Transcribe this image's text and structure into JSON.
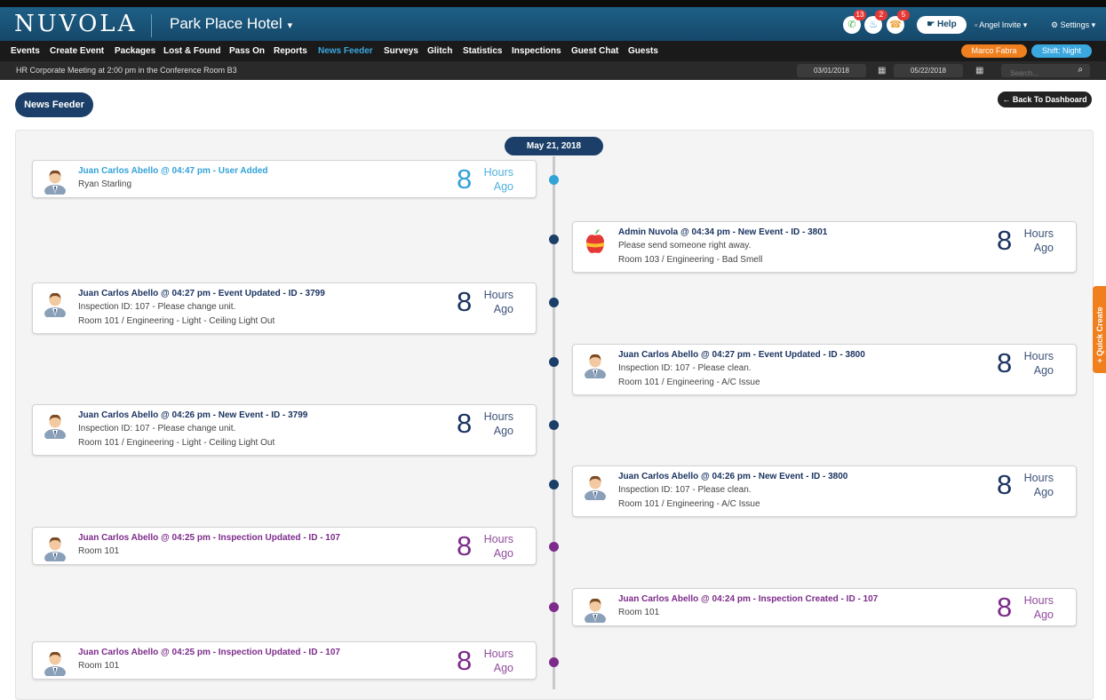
{
  "app": {
    "logo": "NUVOLA",
    "hotel": "Park Place Hotel",
    "hotel_caret": "▾"
  },
  "notifications": [
    {
      "name": "chat-notification-icon",
      "icon": "✆",
      "count": "13",
      "color": "#43b649"
    },
    {
      "name": "service-bell-notification-icon",
      "icon": "♨",
      "count": "2",
      "color": "#2f9ad6"
    },
    {
      "name": "phone-notification-icon",
      "icon": "☎",
      "count": "5",
      "color": "#f2a33a"
    }
  ],
  "top_right": {
    "help": "☛ Help",
    "invite": "▫ Angel Invite ▾",
    "settings": "⚙ Settings ▾"
  },
  "nav": {
    "items": [
      "Events",
      "Create Event",
      "Packages",
      "Lost & Found",
      "Pass On",
      "Reports",
      "News Feeder",
      "Surveys",
      "Glitch",
      "Statistics",
      "Inspections",
      "Guest Chat",
      "Guests"
    ],
    "active": "News Feeder",
    "user": "Marco Fabra",
    "shift": "Shift: Night"
  },
  "subbar": {
    "ticker": "HR Corporate Meeting at 2:00 pm in the Conference Room B3",
    "start_date": "03/01/2018",
    "end_date": "05/22/2018",
    "search_placeholder": "Search...",
    "cal_icon": "▦",
    "search_icon": "⌕"
  },
  "page": {
    "news_feeder_button": "News Feeder",
    "back_button": "← Back To Dashboard",
    "date_label": "May 21, 2018",
    "quick_create": "+ Quick Create"
  },
  "colors": {
    "user_added": "#32a2d9",
    "event": "#1b3461",
    "inspection": "#7d2b8b",
    "dot_event": "#1b3f68"
  },
  "feed": [
    {
      "title": "Juan Carlos Abello @ 04:47 pm - User Added",
      "lines": [
        "Ryan Starling"
      ],
      "num": "8",
      "unit_1": "Hours",
      "unit_2": "Ago",
      "kind": "user_added",
      "avatar": "user"
    },
    {
      "title": "Admin Nuvola @ 04:34 pm - New Event - ID - 3801",
      "lines": [
        "Please send someone right away.",
        "Room 103 / Engineering - Bad Smell"
      ],
      "num": "8",
      "unit_1": "Hours",
      "unit_2": "Ago",
      "kind": "event",
      "avatar": "apple"
    },
    {
      "title": "Juan Carlos Abello @ 04:27 pm - Event Updated - ID - 3799",
      "lines": [
        "Inspection ID: 107 - Please change unit.",
        "Room 101 / Engineering - Light - Ceiling Light Out"
      ],
      "num": "8",
      "unit_1": "Hours",
      "unit_2": "Ago",
      "kind": "event",
      "avatar": "user"
    },
    {
      "title": "Juan Carlos Abello @ 04:27 pm - Event Updated - ID - 3800",
      "lines": [
        "Inspection ID: 107 - Please clean.",
        "Room 101 / Engineering - A/C Issue"
      ],
      "num": "8",
      "unit_1": "Hours",
      "unit_2": "Ago",
      "kind": "event",
      "avatar": "user"
    },
    {
      "title": "Juan Carlos Abello @ 04:26 pm - New Event - ID - 3799",
      "lines": [
        "Inspection ID: 107 - Please change unit.",
        "Room 101 / Engineering - Light - Ceiling Light Out"
      ],
      "num": "8",
      "unit_1": "Hours",
      "unit_2": "Ago",
      "kind": "event",
      "avatar": "user"
    },
    {
      "title": "Juan Carlos Abello @ 04:26 pm - New Event - ID - 3800",
      "lines": [
        "Inspection ID: 107 - Please clean.",
        "Room 101 / Engineering - A/C Issue"
      ],
      "num": "8",
      "unit_1": "Hours",
      "unit_2": "Ago",
      "kind": "event",
      "avatar": "user"
    },
    {
      "title": "Juan Carlos Abello @ 04:25 pm - Inspection Updated - ID - 107",
      "lines": [
        "Room 101"
      ],
      "num": "8",
      "unit_1": "Hours",
      "unit_2": "Ago",
      "kind": "inspection",
      "avatar": "user"
    },
    {
      "title": "Juan Carlos Abello @ 04:24 pm - Inspection Created - ID - 107",
      "lines": [
        "Room 101"
      ],
      "num": "8",
      "unit_1": "Hours",
      "unit_2": "Ago",
      "kind": "inspection",
      "avatar": "user"
    },
    {
      "title": "Juan Carlos Abello @ 04:25 pm - Inspection Updated - ID - 107",
      "lines": [
        "Room 101"
      ],
      "num": "8",
      "unit_1": "Hours",
      "unit_2": "Ago",
      "kind": "inspection",
      "avatar": "user"
    }
  ]
}
